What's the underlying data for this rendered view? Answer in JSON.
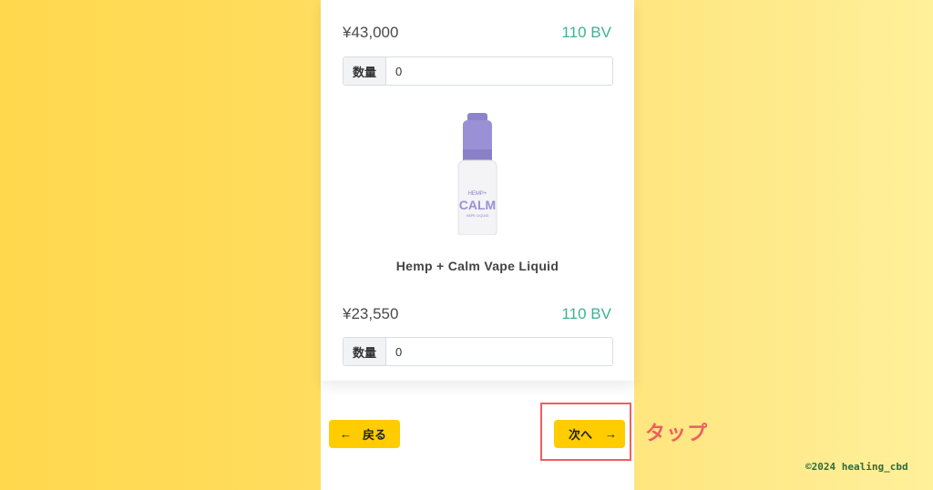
{
  "products": [
    {
      "price": "¥43,000",
      "bv": "110 BV",
      "qty_label": "数量",
      "qty_value": "0"
    },
    {
      "name": "Hemp + Calm Vape Liquid",
      "price": "¥23,550",
      "bv": "110 BV",
      "qty_label": "数量",
      "qty_value": "0",
      "bottle_text": {
        "line1": "HEMP+",
        "line2": "CALM",
        "line3": "VAPE LIQUID"
      }
    }
  ],
  "nav": {
    "back_label": "戻る",
    "back_icon": "←",
    "next_label": "次へ",
    "next_icon": "→"
  },
  "annotation": {
    "tap_label": "タップ"
  },
  "footer": {
    "copyright": "©2024 healing_cbd"
  },
  "colors": {
    "accent": "#ffcc00",
    "bv": "#3cb38f",
    "annotation": "#ee5f63"
  }
}
